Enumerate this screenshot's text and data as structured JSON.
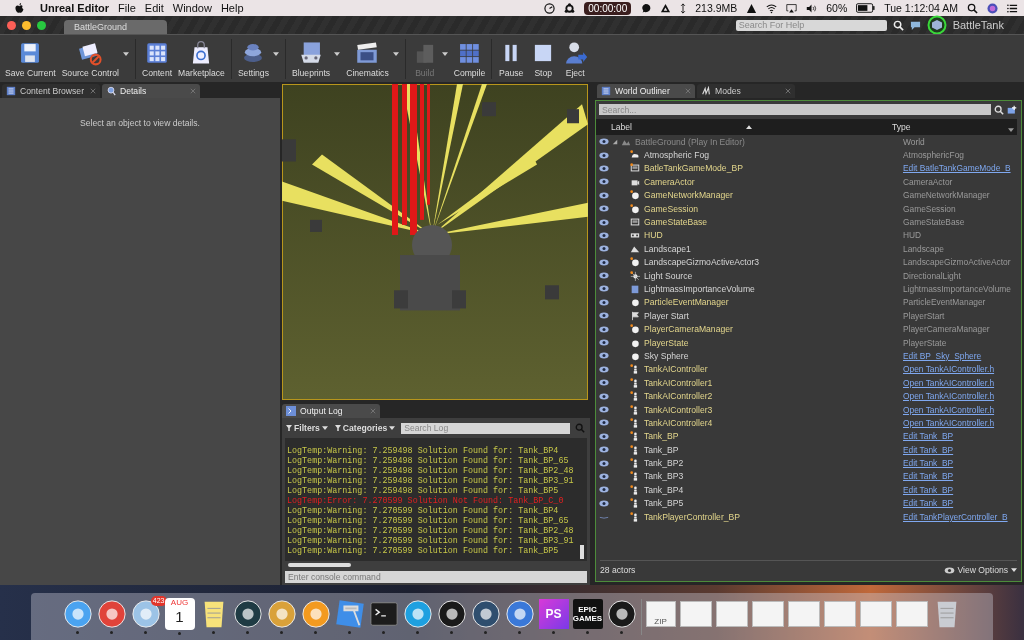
{
  "menubar": {
    "app_name": "Unreal Editor",
    "menus": [
      "File",
      "Edit",
      "Window",
      "Help"
    ],
    "timer": "00:00:00",
    "memory": "213.9MB",
    "battery": "60%",
    "clock": "Tue 1:12:04 AM"
  },
  "window": {
    "tab": "BattleGround",
    "help_search": {
      "placeholder": "Search For Help"
    },
    "project": "BattleTank"
  },
  "toolbar": [
    {
      "label": "Save Current",
      "kind": "save",
      "has_menu": false,
      "disabled": false,
      "separator_before": false
    },
    {
      "label": "Source Control",
      "kind": "source",
      "has_menu": true,
      "disabled": false,
      "separator_before": false
    },
    {
      "label": "Content",
      "kind": "content",
      "has_menu": false,
      "disabled": false,
      "separator_before": true
    },
    {
      "label": "Marketplace",
      "kind": "market",
      "has_menu": false,
      "disabled": false,
      "separator_before": false
    },
    {
      "label": "Settings",
      "kind": "settings",
      "has_menu": true,
      "disabled": false,
      "separator_before": true
    },
    {
      "label": "Blueprints",
      "kind": "blueprints",
      "has_menu": true,
      "disabled": false,
      "separator_before": true
    },
    {
      "label": "Cinematics",
      "kind": "cinematics",
      "has_menu": true,
      "disabled": false,
      "separator_before": false
    },
    {
      "label": "Build",
      "kind": "build",
      "has_menu": true,
      "disabled": true,
      "separator_before": true
    },
    {
      "label": "Compile",
      "kind": "compile",
      "has_menu": false,
      "disabled": false,
      "separator_before": false
    },
    {
      "label": "Pause",
      "kind": "pause",
      "has_menu": false,
      "disabled": false,
      "separator_before": true
    },
    {
      "label": "Stop",
      "kind": "stop",
      "has_menu": false,
      "disabled": false,
      "separator_before": false
    },
    {
      "label": "Eject",
      "kind": "eject",
      "has_menu": false,
      "disabled": false,
      "separator_before": false
    }
  ],
  "left_panel": {
    "tabs": [
      {
        "label": "Content Browser",
        "kind": "browser",
        "selected": false
      },
      {
        "label": "Details",
        "kind": "details",
        "selected": true
      }
    ],
    "message": "Select an object to view details."
  },
  "output_log": {
    "tab": "Output Log",
    "filters": "Filters",
    "categories": "Categories",
    "search": {
      "placeholder": "Search Log"
    },
    "lines": [
      {
        "text": "LogTemp:Warning: 7.259498 Solution Found for: Tank_BP4",
        "kind": "warning"
      },
      {
        "text": "LogTemp:Warning: 7.259498 Solution Found for: Tank_BP_65",
        "kind": "warning"
      },
      {
        "text": "LogTemp:Warning: 7.259498 Solution Found for: Tank_BP2_48",
        "kind": "warning"
      },
      {
        "text": "LogTemp:Warning: 7.259498 Solution Found for: Tank_BP3_91",
        "kind": "warning"
      },
      {
        "text": "LogTemp:Warning: 7.259498 Solution Found for: Tank_BP5",
        "kind": "warning"
      },
      {
        "text": "LogTemp:Error: 7.270599 Solution Not Found: Tank_BP_C_0",
        "kind": "error"
      },
      {
        "text": "LogTemp:Warning: 7.270599 Solution Found for: Tank_BP4",
        "kind": "warning"
      },
      {
        "text": "LogTemp:Warning: 7.270599 Solution Found for: Tank_BP_65",
        "kind": "warning"
      },
      {
        "text": "LogTemp:Warning: 7.270599 Solution Found for: Tank_BP2_48",
        "kind": "warning"
      },
      {
        "text": "LogTemp:Warning: 7.270599 Solution Found for: Tank_BP3_91",
        "kind": "warning"
      },
      {
        "text": "LogTemp:Warning: 7.270599 Solution Found for: Tank_BP5",
        "kind": "warning"
      }
    ],
    "console": {
      "placeholder": "Enter console command"
    }
  },
  "outliner": {
    "tabs": [
      {
        "label": "World Outliner",
        "kind": "list",
        "selected": true
      },
      {
        "label": "Modes",
        "kind": "modes",
        "selected": false
      }
    ],
    "search": {
      "placeholder": "Search..."
    },
    "columns": [
      "Label",
      "Type"
    ],
    "tree": [
      {
        "label": "BattleGround (Play In Editor)",
        "type": "World",
        "kind": "world",
        "blueprint": false,
        "link": false,
        "flagged": false,
        "visible": true,
        "expanded": true,
        "children": [
          {
            "label": "Atmospheric Fog",
            "type": "AtmosphericFog",
            "kind": "fog",
            "blueprint": false,
            "link": false,
            "flagged": true,
            "visible": true
          },
          {
            "label": "BatleTankGameMode_BP",
            "type": "Edit BatleTankGameMode_B",
            "kind": "gamemode",
            "blueprint": true,
            "link": true,
            "flagged": true,
            "visible": true
          },
          {
            "label": "CameraActor",
            "type": "CameraActor",
            "kind": "camera",
            "blueprint": true,
            "link": false,
            "flagged": false,
            "visible": true
          },
          {
            "label": "GameNetworkManager",
            "type": "GameNetworkManager",
            "kind": "sphere",
            "blueprint": true,
            "link": false,
            "flagged": true,
            "visible": true
          },
          {
            "label": "GameSession",
            "type": "GameSession",
            "kind": "sphere",
            "blueprint": true,
            "link": false,
            "flagged": true,
            "visible": true
          },
          {
            "label": "GameStateBase",
            "type": "GameStateBase",
            "kind": "screen",
            "blueprint": true,
            "link": false,
            "flagged": false,
            "visible": true
          },
          {
            "label": "HUD",
            "type": "HUD",
            "kind": "hud",
            "blueprint": true,
            "link": false,
            "flagged": false,
            "visible": true
          },
          {
            "label": "Landscape1",
            "type": "Landscape",
            "kind": "landscape",
            "blueprint": false,
            "link": false,
            "flagged": false,
            "visible": true
          },
          {
            "label": "LandscapeGizmoActiveActor3",
            "type": "LandscapeGizmoActiveActor",
            "kind": "sphere",
            "blueprint": false,
            "link": false,
            "flagged": true,
            "visible": true
          },
          {
            "label": "Light Source",
            "type": "DirectionalLight",
            "kind": "light",
            "blueprint": false,
            "link": false,
            "flagged": true,
            "visible": true
          },
          {
            "label": "LightmassImportanceVolume",
            "type": "LightmassImportanceVolume",
            "kind": "volume",
            "blueprint": false,
            "link": false,
            "flagged": false,
            "visible": true
          },
          {
            "label": "ParticleEventManager",
            "type": "ParticleEventManager",
            "kind": "sphere",
            "blueprint": true,
            "link": false,
            "flagged": false,
            "visible": true
          },
          {
            "label": "Player Start",
            "type": "PlayerStart",
            "kind": "start",
            "blueprint": false,
            "link": false,
            "flagged": false,
            "visible": true
          },
          {
            "label": "PlayerCameraManager",
            "type": "PlayerCameraManager",
            "kind": "sphere",
            "blueprint": true,
            "link": false,
            "flagged": true,
            "visible": true
          },
          {
            "label": "PlayerState",
            "type": "PlayerState",
            "kind": "sphere",
            "blueprint": true,
            "link": false,
            "flagged": false,
            "visible": true
          },
          {
            "label": "Sky Sphere",
            "type": "Edit BP_Sky_Sphere",
            "kind": "sphere",
            "blueprint": false,
            "link": true,
            "flagged": false,
            "visible": true
          },
          {
            "label": "TankAIController",
            "type": "Open TankAIController.h",
            "kind": "controller",
            "blueprint": true,
            "link": true,
            "flagged": true,
            "visible": true
          },
          {
            "label": "TankAIController1",
            "type": "Open TankAIController.h",
            "kind": "controller",
            "blueprint": true,
            "link": true,
            "flagged": true,
            "visible": true
          },
          {
            "label": "TankAIController2",
            "type": "Open TankAIController.h",
            "kind": "controller",
            "blueprint": true,
            "link": true,
            "flagged": true,
            "visible": true
          },
          {
            "label": "TankAIController3",
            "type": "Open TankAIController.h",
            "kind": "controller",
            "blueprint": true,
            "link": true,
            "flagged": true,
            "visible": true
          },
          {
            "label": "TankAIController4",
            "type": "Open TankAIController.h",
            "kind": "controller",
            "blueprint": true,
            "link": true,
            "flagged": true,
            "visible": true
          },
          {
            "label": "Tank_BP",
            "type": "Edit Tank_BP",
            "kind": "pawn",
            "blueprint": true,
            "link": true,
            "flagged": true,
            "visible": true
          },
          {
            "label": "Tank_BP",
            "type": "Edit Tank_BP",
            "kind": "pawn",
            "blueprint": false,
            "link": true,
            "flagged": true,
            "visible": true
          },
          {
            "label": "Tank_BP2",
            "type": "Edit Tank_BP",
            "kind": "pawn",
            "blueprint": false,
            "link": true,
            "flagged": true,
            "visible": true
          },
          {
            "label": "Tank_BP3",
            "type": "Edit Tank_BP",
            "kind": "pawn",
            "blueprint": false,
            "link": true,
            "flagged": true,
            "visible": true
          },
          {
            "label": "Tank_BP4",
            "type": "Edit Tank_BP",
            "kind": "pawn",
            "blueprint": false,
            "link": true,
            "flagged": true,
            "visible": true
          },
          {
            "label": "Tank_BP5",
            "type": "Edit Tank_BP",
            "kind": "pawn",
            "blueprint": false,
            "link": true,
            "flagged": true,
            "visible": true
          },
          {
            "label": "TankPlayerController_BP",
            "type": "Edit TankPlayerController_B",
            "kind": "controller",
            "blueprint": true,
            "link": true,
            "flagged": true,
            "visible": false
          }
        ]
      }
    ],
    "footer": "28 actors",
    "view_options": "View Options"
  },
  "dock": [
    {
      "kind": "finder",
      "running": true
    },
    {
      "kind": "chrome",
      "running": true
    },
    {
      "kind": "mail",
      "running": true,
      "badge": "423"
    },
    {
      "kind": "calendar",
      "running": true,
      "month": "AUG",
      "day": "1"
    },
    {
      "kind": "notes",
      "running": true
    },
    {
      "kind": "league",
      "running": true
    },
    {
      "kind": "database",
      "running": true
    },
    {
      "kind": "orange",
      "running": true
    },
    {
      "kind": "hammer",
      "running": true
    },
    {
      "kind": "terminal",
      "running": true
    },
    {
      "kind": "skype",
      "running": true
    },
    {
      "kind": "unreal",
      "running": true
    },
    {
      "kind": "tree",
      "running": true
    },
    {
      "kind": "hexagon",
      "running": true
    },
    {
      "kind": "phpstorm",
      "running": true,
      "label": "PS"
    },
    {
      "kind": "epic",
      "running": true,
      "label": "EPIC GAMES"
    },
    {
      "kind": "unreal",
      "running": true
    },
    {
      "kind": "separator"
    },
    {
      "kind": "zip",
      "running": false,
      "label": "ZIP"
    },
    {
      "kind": "thumbnail",
      "running": false
    },
    {
      "kind": "thumbnail",
      "running": false
    },
    {
      "kind": "thumbnail",
      "running": false
    },
    {
      "kind": "thumbnail",
      "running": false
    },
    {
      "kind": "thumbnail",
      "running": false
    },
    {
      "kind": "thumbnail",
      "running": false
    },
    {
      "kind": "thumbnail",
      "running": false
    },
    {
      "kind": "trash",
      "running": false
    }
  ]
}
